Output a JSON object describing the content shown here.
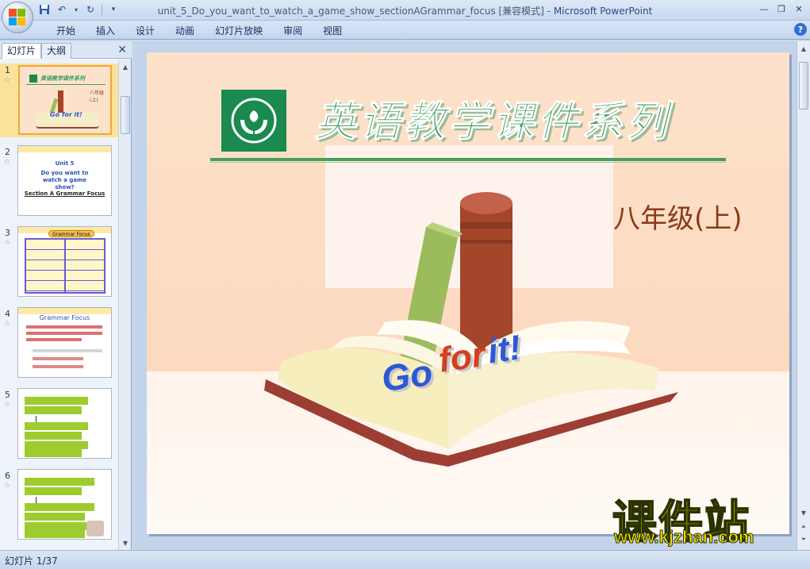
{
  "window": {
    "title": "unit_5_Do_you_want_to_watch_a_game_show_sectionAGrammar_focus [兼容模式] - ",
    "app_name": "Microsoft PowerPoint"
  },
  "ribbon": {
    "tabs": [
      "开始",
      "插入",
      "设计",
      "动画",
      "幻灯片放映",
      "审阅",
      "视图"
    ]
  },
  "left_pane": {
    "tab_slides": "幻灯片",
    "tab_outline": "大纲",
    "thumbnails": [
      {
        "num": "1",
        "title": "英语教学课件系列",
        "grade": "八年级(上)",
        "gofor": "Go for it!"
      },
      {
        "num": "2",
        "line1": "Unit 5",
        "line2": "Do you want to watch a game show?",
        "line3": "Section A Grammar Focus"
      },
      {
        "num": "3",
        "header": "Grammar Focus"
      },
      {
        "num": "4",
        "title": "Grammar Focus"
      },
      {
        "num": "5"
      },
      {
        "num": "6"
      }
    ]
  },
  "slide": {
    "title": "英语教学课件系列",
    "grade": "八年级(上)",
    "gofor": [
      "Go",
      "for",
      "it!"
    ]
  },
  "watermark": {
    "cn": "课件站",
    "url": "www.kjzhan.com"
  },
  "status": {
    "slide_indicator": "幻灯片 1/37"
  },
  "colors": {
    "title_green": "#2f9e58",
    "logo_green": "#1a8a4e",
    "grade_brown": "#8a3a17",
    "selected_thumb": "#fbe19a"
  }
}
